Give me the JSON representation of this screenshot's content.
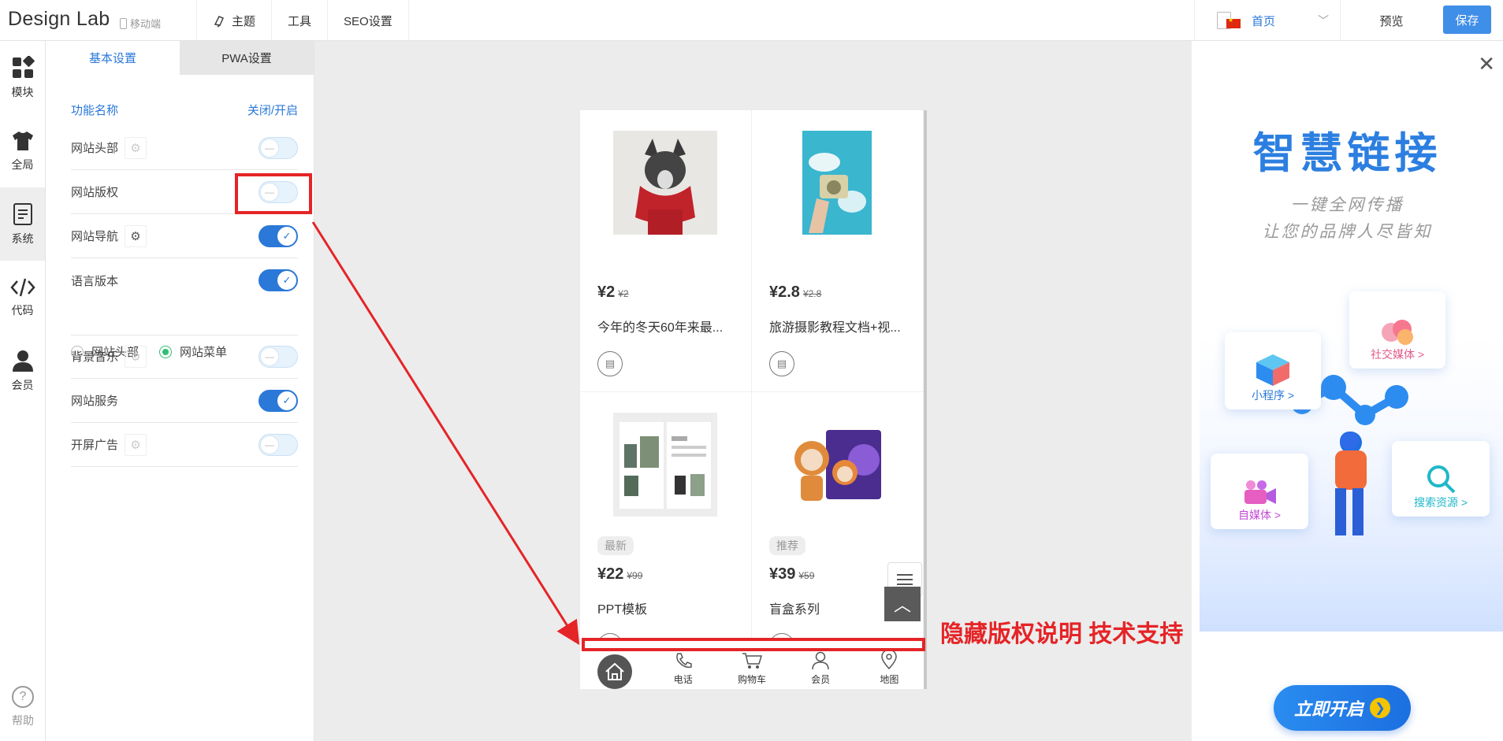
{
  "header": {
    "logo": "Design Lab",
    "mobile_label": "移动端",
    "nav": [
      "主题",
      "工具",
      "SEO设置"
    ],
    "page_select": "首页",
    "preview": "预览",
    "save": "保存"
  },
  "rail": {
    "items": [
      {
        "label": "模块",
        "icon": "grid-icon"
      },
      {
        "label": "全局",
        "icon": "shirt-icon"
      },
      {
        "label": "系统",
        "icon": "document-icon"
      },
      {
        "label": "代码",
        "icon": "code-icon"
      },
      {
        "label": "会员",
        "icon": "user-icon"
      }
    ],
    "help": "帮助"
  },
  "settings": {
    "tabs": [
      "基本设置",
      "PWA设置"
    ],
    "col_name": "功能名称",
    "col_toggle": "关闭/开启",
    "rows": [
      {
        "label": "网站头部",
        "on": false
      },
      {
        "label": "网站版权",
        "on": false
      },
      {
        "label": "网站导航",
        "on": true
      },
      {
        "label": "语言版本",
        "on": true
      },
      {
        "label": "背景音乐",
        "on": false
      },
      {
        "label": "网站服务",
        "on": true
      },
      {
        "label": "开屏广告",
        "on": false
      }
    ],
    "language_options": [
      "网站头部",
      "网站菜单"
    ],
    "language_selected": "网站菜单"
  },
  "preview": {
    "products": [
      {
        "price": "¥2",
        "old_price": "¥2",
        "title": "今年的冬天60年来最...",
        "badge": ""
      },
      {
        "price": "¥2.8",
        "old_price": "¥2.8",
        "title": "旅游摄影教程文档+视...",
        "badge": ""
      },
      {
        "price": "¥22",
        "old_price": "¥99",
        "title": "PPT模板",
        "badge": "最新"
      },
      {
        "price": "¥39",
        "old_price": "¥59",
        "title": "盲盒系列",
        "badge": "推荐"
      }
    ],
    "bottom_nav": [
      "电话",
      "购物车",
      "会员",
      "地图"
    ]
  },
  "annotation": {
    "text": "隐藏版权说明 技术支持",
    "color": "#e52427"
  },
  "ad": {
    "headline": "智慧链接",
    "sub1": "一键全网传播",
    "sub2": "让您的品牌人尽皆知",
    "tags": [
      "社交媒体 >",
      "小程序 >",
      "自媒体 >",
      "搜索资源 >"
    ],
    "cta": "立即开启"
  }
}
